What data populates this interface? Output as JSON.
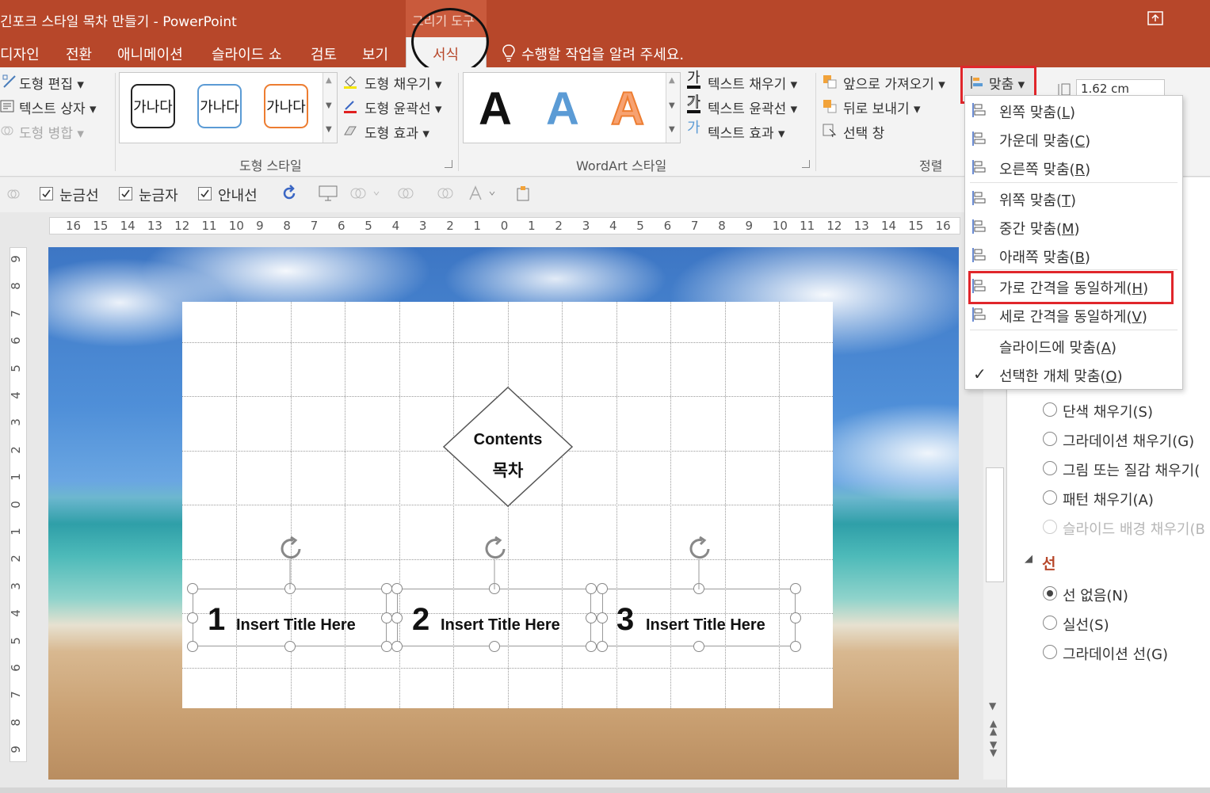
{
  "window": {
    "title": "긴포크 스타일 목차 만들기 - PowerPoint",
    "context_tab_group": "그리기 도구"
  },
  "menu": {
    "items": [
      "디자인",
      "전환",
      "애니메이션",
      "슬라이드 쇼",
      "검토",
      "보기"
    ],
    "active_tab": "서식",
    "tell_me": "수행할 작업을 알려 주세요."
  },
  "ribbon": {
    "insert_shapes": {
      "edit_shape": "도형 편집",
      "text_box": "텍스트 상자",
      "merge_shapes": "도형 병합"
    },
    "shape_styles": {
      "swatch_label": "가나다",
      "shape_fill": "도형 채우기",
      "shape_outline": "도형 윤곽선",
      "shape_effects": "도형 효과",
      "group_label": "도형 스타일"
    },
    "wordart": {
      "letter": "A",
      "text_fill": "텍스트 채우기",
      "text_outline": "텍스트 윤곽선",
      "text_effects": "텍스트 효과",
      "group_label": "WordArt 스타일",
      "fill_glyph": "가"
    },
    "arrange": {
      "bring_forward": "앞으로 가져오기",
      "send_backward": "뒤로 보내기",
      "selection_pane": "선택 창",
      "group_label": "정렬",
      "align_button": "맞춤"
    },
    "size": {
      "height_value": "1.62 cm"
    }
  },
  "align_menu": {
    "items": [
      {
        "label": "왼쪽 맞춤",
        "key": "L"
      },
      {
        "label": "가운데 맞춤",
        "key": "C"
      },
      {
        "label": "오른쪽 맞춤",
        "key": "R"
      },
      {
        "label": "위쪽 맞춤",
        "key": "T"
      },
      {
        "label": "중간 맞춤",
        "key": "M"
      },
      {
        "label": "아래쪽 맞춤",
        "key": "B"
      },
      {
        "label": "가로 간격을 동일하게",
        "key": "H"
      },
      {
        "label": "세로 간격을 동일하게",
        "key": "V"
      },
      {
        "label": "슬라이드에 맞춤",
        "key": "A"
      },
      {
        "label": "선택한 개체 맞춤",
        "key": "O"
      }
    ],
    "checkmark": "✓"
  },
  "view_options": {
    "gridlines": "눈금선",
    "ruler": "눈금자",
    "guides": "안내선"
  },
  "ruler": {
    "horizontal": [
      "16",
      "15",
      "14",
      "13",
      "12",
      "11",
      "10",
      "9",
      "8",
      "7",
      "6",
      "5",
      "4",
      "3",
      "2",
      "1",
      "0",
      "1",
      "2",
      "3",
      "4",
      "5",
      "6",
      "7",
      "8",
      "9",
      "10",
      "11",
      "12",
      "13",
      "14",
      "15",
      "16"
    ],
    "vertical": [
      "9",
      "8",
      "7",
      "6",
      "5",
      "4",
      "3",
      "2",
      "1",
      "0",
      "1",
      "2",
      "3",
      "4",
      "5",
      "6",
      "7",
      "8",
      "9"
    ]
  },
  "slide": {
    "diamond_title": "Contents",
    "diamond_subtitle": "목차",
    "items": [
      {
        "number": "1",
        "title": "Insert Title Here"
      },
      {
        "number": "2",
        "title": "Insert Title Here"
      },
      {
        "number": "3",
        "title": "Insert Title Here"
      }
    ]
  },
  "format_pane": {
    "fill_options": [
      "단색 채우기(S)",
      "그라데이션 채우기(G)",
      "그림 또는 질감 채우기(",
      "패턴 채우기(A)",
      "슬라이드 배경 채우기(B"
    ],
    "line_section": "선",
    "line_options": [
      "선 없음(N)",
      "실선(S)",
      "그라데이션 선(G)"
    ],
    "selected_line_option": "선 없음(N)"
  },
  "colors": {
    "accent": "#b7472a",
    "highlight": "#e0262b"
  }
}
